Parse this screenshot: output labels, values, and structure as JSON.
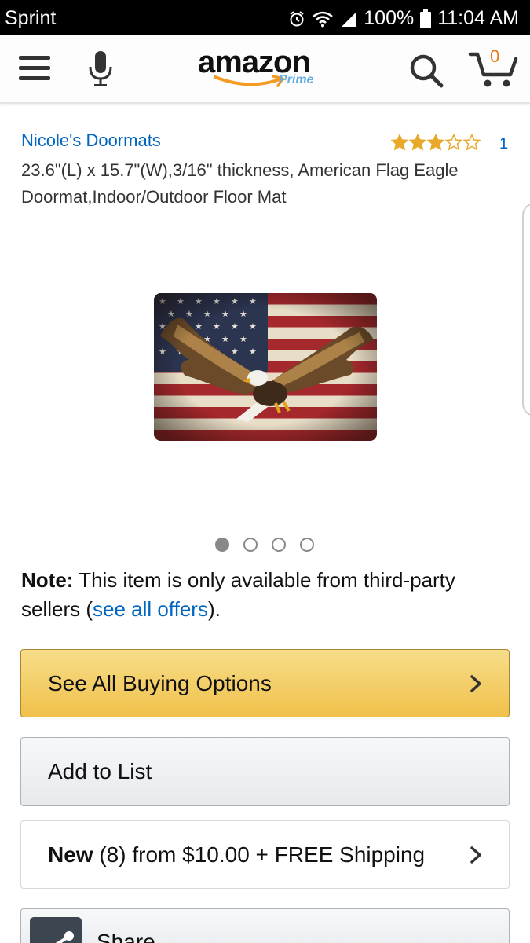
{
  "status_bar": {
    "carrier": "Sprint",
    "battery": "100%",
    "time": "11:04 AM"
  },
  "header": {
    "logo_text": "amazon",
    "logo_sub": "Prime",
    "cart_count": "0"
  },
  "product": {
    "seller": "Nicole's Doormats",
    "rating": 3,
    "rating_count": "1",
    "title": "23.6\"(L) x 15.7\"(W),3/16\" thickness, American Flag Eagle Doormat,Indoor/Outdoor Floor Mat"
  },
  "carousel": {
    "image_count": 4,
    "active_index": 0
  },
  "note": {
    "label": "Note:",
    "text_before": " This item is only available from third-party sellers (",
    "link": "see all offers",
    "text_after": ")."
  },
  "buttons": {
    "buying_options": "See All Buying Options",
    "add_to_list": "Add to List",
    "new_label": "New",
    "new_detail": " (8) from $10.00 + FREE Shipping",
    "share": "Share"
  },
  "colors": {
    "link": "#0066c0",
    "star": "#e8a82a",
    "cart_accent": "#e47911",
    "buy_button": "#f0c14b"
  },
  "icons": [
    "menu-icon",
    "microphone-icon",
    "search-icon",
    "cart-icon",
    "chevron-right-icon",
    "share-icon",
    "alarm-icon",
    "wifi-icon",
    "signal-icon",
    "battery-icon"
  ]
}
